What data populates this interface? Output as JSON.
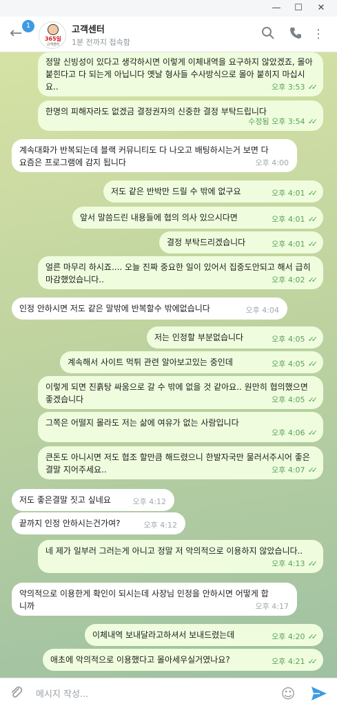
{
  "header": {
    "badge": "1",
    "avatar_text": "365일",
    "avatar_sub": "고객센터",
    "title": "고객센터",
    "status": "1분 전까지 접속함"
  },
  "messages": [
    {
      "dir": "out",
      "text": "정말 신빙성이 있다고 생각하시면 이렇게 이체내역을 요구하지 않았겠죠, 몰아 붙힌다고 다 되는게 아닙니다 옛날 형사들 수사방식으로 몰아 붙히지 마십시요..",
      "time": "오후 3:53"
    },
    {
      "dir": "out",
      "text": "한명의 피해자라도 없겠금 결정권자의 신중한 결정 부탁드립니다",
      "time": "수정됨 오후 3:54"
    },
    {
      "dir": "in",
      "text": "계속대화가 반복되는데 블랙 커뮤니티도 다 나오고 배팅하시는거 보면 다 요즘은 프로그램에 감지 됩니다",
      "time": "오후 4:00"
    },
    {
      "dir": "out",
      "text": "저도 같은 반박만 드릴 수 밖에 없구요",
      "time": "오후 4:01"
    },
    {
      "dir": "out",
      "text": "앞서 말씀드린 내용들에 협의 의사 있으시다면",
      "time": "오후 4:01"
    },
    {
      "dir": "out",
      "text": "결정 부탁드리겠습니다",
      "time": "오후 4:01"
    },
    {
      "dir": "out",
      "text": "얼른 마무리 하시죠.... 오늘 진짜 중요한 일이 있어서 집중도안되고 해서 급히 마감했었습니다..",
      "time": "오후 4:02"
    },
    {
      "dir": "in",
      "text": "인정 안하시면 저도 같은 말밖에 반복할수 밖에없습니다",
      "time": "오후 4:04"
    },
    {
      "dir": "out",
      "text": "저는 인정할 부분없습니다",
      "time": "오후 4:05"
    },
    {
      "dir": "out",
      "text": "계속해서 사이트 먹튀 관련 알아보고있는 중인데",
      "time": "오후 4:05"
    },
    {
      "dir": "out",
      "text": "이렇게 되면 진흙탕 싸움으로 갈 수 밖에 없을 것 같아요.. 원만히 협의했으면 좋겠습니다",
      "time": "오후 4:05"
    },
    {
      "dir": "out",
      "text": "그쪽은 어떨지 몰라도 저는 삶에 여유가 없는 사람입니다",
      "time": "오후 4:06"
    },
    {
      "dir": "out",
      "text": "큰돈도 아니시면 저도 협조 할만큼 해드렸으니 한발자국만 물러서주시어 좋은 결말 지어주세요..",
      "time": "오후 4:07"
    },
    {
      "dir": "in",
      "text": "저도 좋은결말 짓고 싶네요",
      "time": "오후 4:12"
    },
    {
      "dir": "in",
      "text": "끝까지 인정 안하시는건가여?",
      "time": "오후 4:12"
    },
    {
      "dir": "out",
      "text": "네 제가 일부러 그러는게 아니고 정말 저 악의적으로 이용하지 않았습니다..",
      "time": "오후 4:13"
    },
    {
      "dir": "in",
      "text": "악의적으로 이용한게 확인이 되시는데 사장님 인정을 안하시면 어떻게 합니까",
      "time": "오후 4:17"
    },
    {
      "dir": "out",
      "text": "이체내역 보내달라고하셔서 보내드렸는데",
      "time": "오후 4:20"
    },
    {
      "dir": "out",
      "text": "애초에 악의적으로 이용했다고 몰아세우실거였나요?",
      "time": "오후 4:21"
    }
  ],
  "composer": {
    "placeholder": "메시지 작성..."
  },
  "colors": {
    "outgoing_bubble": "#effdde",
    "incoming_bubble": "#ffffff",
    "accent": "#3e9be2",
    "check": "#4ea34f"
  }
}
